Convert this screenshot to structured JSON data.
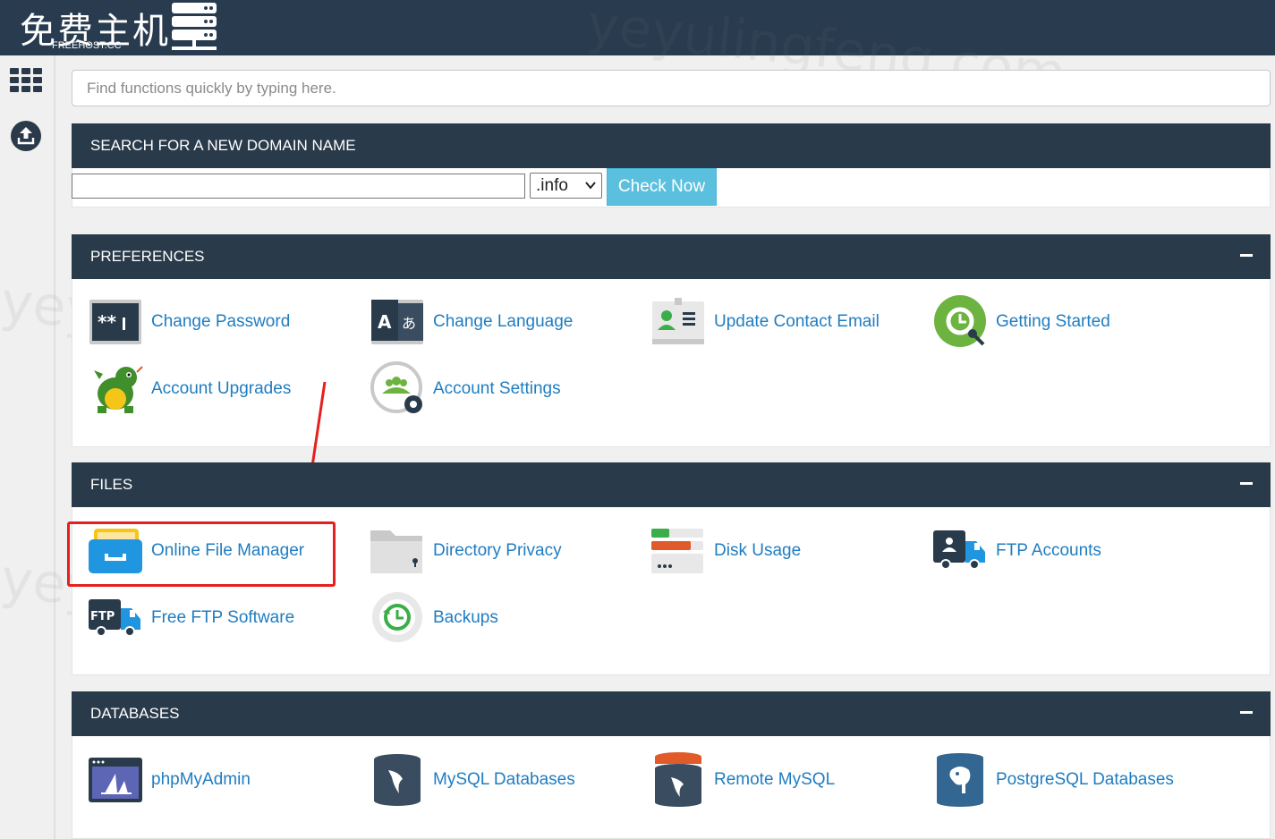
{
  "brand": {
    "name_cn": "免费主机",
    "name_en": "FREEHOST.CC",
    "watermark": "yeyulingfeng.com"
  },
  "sidebar": {
    "items": [
      {
        "icon": "apps-grid-icon"
      },
      {
        "icon": "upload-icon"
      }
    ]
  },
  "search": {
    "placeholder": "Find functions quickly by typing here."
  },
  "domain_search": {
    "title": "SEARCH FOR A NEW DOMAIN NAME",
    "input_value": "",
    "tld_selected": ".info",
    "button_label": "Check Now"
  },
  "preferences": {
    "title": "PREFERENCES",
    "items": [
      {
        "label": "Change Password",
        "icon": "password-icon"
      },
      {
        "label": "Change Language",
        "icon": "language-icon"
      },
      {
        "label": "Update Contact Email",
        "icon": "contact-card-icon"
      },
      {
        "label": "Getting Started",
        "icon": "getting-started-icon"
      },
      {
        "label": "Account Upgrades",
        "icon": "dragon-mascot-icon"
      },
      {
        "label": "Account Settings",
        "icon": "account-settings-icon"
      }
    ]
  },
  "files": {
    "title": "FILES",
    "items": [
      {
        "label": "Online File Manager",
        "icon": "file-manager-icon"
      },
      {
        "label": "Directory Privacy",
        "icon": "folder-lock-icon"
      },
      {
        "label": "Disk Usage",
        "icon": "disk-usage-icon"
      },
      {
        "label": "FTP Accounts",
        "icon": "ftp-truck-icon"
      },
      {
        "label": "Free FTP Software",
        "icon": "ftp-software-icon"
      },
      {
        "label": "Backups",
        "icon": "backup-icon"
      }
    ]
  },
  "databases": {
    "title": "DATABASES",
    "items": [
      {
        "label": "phpMyAdmin",
        "icon": "phpmyadmin-icon"
      },
      {
        "label": "MySQL Databases",
        "icon": "mysql-icon"
      },
      {
        "label": "Remote MySQL",
        "icon": "remote-mysql-icon"
      },
      {
        "label": "PostgreSQL Databases",
        "icon": "postgresql-icon"
      }
    ]
  },
  "colors": {
    "header": "#283b4f",
    "panel_header": "#293a4a",
    "link": "#1f7dc1",
    "button": "#5bc0de",
    "highlight": "#e5201e"
  }
}
